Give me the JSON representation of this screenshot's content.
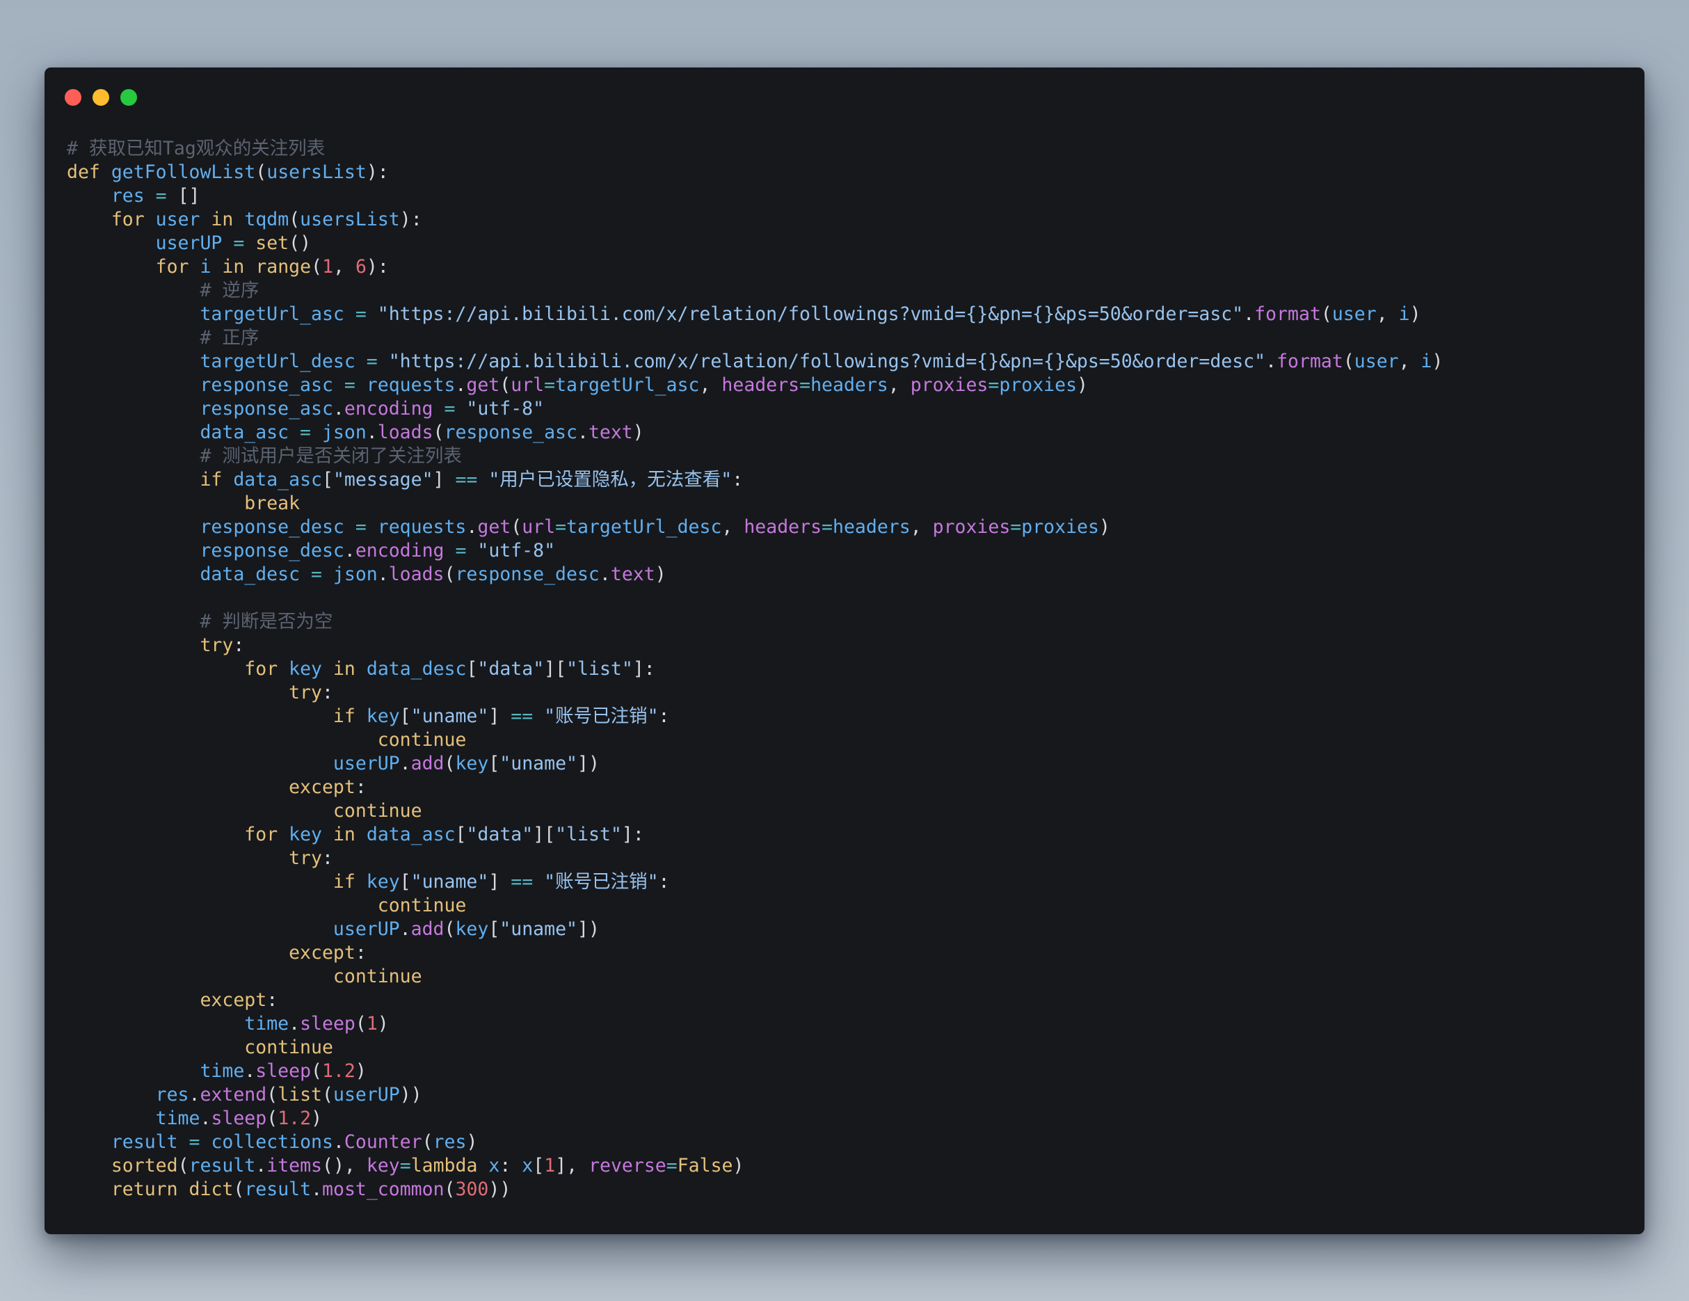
{
  "window": {
    "controls": [
      {
        "name": "close",
        "color": "#ff5f57"
      },
      {
        "name": "minimize",
        "color": "#febc2e"
      },
      {
        "name": "maximize",
        "color": "#28c840"
      }
    ]
  },
  "code": {
    "language": "python",
    "lines": [
      [
        [
          "cm",
          "# 获取已知Tag观众的关注列表"
        ]
      ],
      [
        [
          "kw",
          "def"
        ],
        [
          "pu",
          " "
        ],
        [
          "fn",
          "getFollowList"
        ],
        [
          "pu",
          "("
        ],
        [
          "id",
          "usersList"
        ],
        [
          "pu",
          "):"
        ]
      ],
      [
        [
          "pu",
          "    "
        ],
        [
          "id",
          "res"
        ],
        [
          "op",
          " = "
        ],
        [
          "pu",
          "[]"
        ]
      ],
      [
        [
          "pu",
          "    "
        ],
        [
          "kw",
          "for"
        ],
        [
          "pu",
          " "
        ],
        [
          "id",
          "user"
        ],
        [
          "pu",
          " "
        ],
        [
          "kw",
          "in"
        ],
        [
          "pu",
          " "
        ],
        [
          "fn",
          "tqdm"
        ],
        [
          "pu",
          "("
        ],
        [
          "id",
          "usersList"
        ],
        [
          "pu",
          "):"
        ]
      ],
      [
        [
          "pu",
          "        "
        ],
        [
          "id",
          "userUP"
        ],
        [
          "op",
          " = "
        ],
        [
          "bi",
          "set"
        ],
        [
          "pu",
          "()"
        ]
      ],
      [
        [
          "pu",
          "        "
        ],
        [
          "kw",
          "for"
        ],
        [
          "pu",
          " "
        ],
        [
          "id",
          "i"
        ],
        [
          "pu",
          " "
        ],
        [
          "kw",
          "in"
        ],
        [
          "pu",
          " "
        ],
        [
          "bi",
          "range"
        ],
        [
          "pu",
          "("
        ],
        [
          "nu",
          "1"
        ],
        [
          "pu",
          ", "
        ],
        [
          "nu",
          "6"
        ],
        [
          "pu",
          "):"
        ]
      ],
      [
        [
          "pu",
          "            "
        ],
        [
          "cm",
          "# 逆序"
        ]
      ],
      [
        [
          "pu",
          "            "
        ],
        [
          "id",
          "targetUrl_asc"
        ],
        [
          "op",
          " = "
        ],
        [
          "st",
          "\"https://api.bilibili.com/x/relation/followings?vmid={}&pn={}&ps=50&order=asc\""
        ],
        [
          "pu",
          "."
        ],
        [
          "me",
          "format"
        ],
        [
          "pu",
          "("
        ],
        [
          "id",
          "user"
        ],
        [
          "pu",
          ", "
        ],
        [
          "id",
          "i"
        ],
        [
          "pu",
          ")"
        ]
      ],
      [
        [
          "pu",
          "            "
        ],
        [
          "cm",
          "# 正序"
        ]
      ],
      [
        [
          "pu",
          "            "
        ],
        [
          "id",
          "targetUrl_desc"
        ],
        [
          "op",
          " = "
        ],
        [
          "st",
          "\"https://api.bilibili.com/x/relation/followings?vmid={}&pn={}&ps=50&order=desc\""
        ],
        [
          "pu",
          "."
        ],
        [
          "me",
          "format"
        ],
        [
          "pu",
          "("
        ],
        [
          "id",
          "user"
        ],
        [
          "pu",
          ", "
        ],
        [
          "id",
          "i"
        ],
        [
          "pu",
          ")"
        ]
      ],
      [
        [
          "pu",
          "            "
        ],
        [
          "id",
          "response_asc"
        ],
        [
          "op",
          " = "
        ],
        [
          "id",
          "requests"
        ],
        [
          "pu",
          "."
        ],
        [
          "me",
          "get"
        ],
        [
          "pu",
          "("
        ],
        [
          "pn",
          "url"
        ],
        [
          "op",
          "="
        ],
        [
          "id",
          "targetUrl_asc"
        ],
        [
          "pu",
          ", "
        ],
        [
          "pn",
          "headers"
        ],
        [
          "op",
          "="
        ],
        [
          "id",
          "headers"
        ],
        [
          "pu",
          ", "
        ],
        [
          "pn",
          "proxies"
        ],
        [
          "op",
          "="
        ],
        [
          "id",
          "proxies"
        ],
        [
          "pu",
          ")"
        ]
      ],
      [
        [
          "pu",
          "            "
        ],
        [
          "id",
          "response_asc"
        ],
        [
          "pu",
          "."
        ],
        [
          "me",
          "encoding"
        ],
        [
          "op",
          " = "
        ],
        [
          "st",
          "\"utf-8\""
        ]
      ],
      [
        [
          "pu",
          "            "
        ],
        [
          "id",
          "data_asc"
        ],
        [
          "op",
          " = "
        ],
        [
          "id",
          "json"
        ],
        [
          "pu",
          "."
        ],
        [
          "me",
          "loads"
        ],
        [
          "pu",
          "("
        ],
        [
          "id",
          "response_asc"
        ],
        [
          "pu",
          "."
        ],
        [
          "me",
          "text"
        ],
        [
          "pu",
          ")"
        ]
      ],
      [
        [
          "pu",
          "            "
        ],
        [
          "cm",
          "# 测试用户是否关闭了关注列表"
        ]
      ],
      [
        [
          "pu",
          "            "
        ],
        [
          "kw",
          "if"
        ],
        [
          "pu",
          " "
        ],
        [
          "id",
          "data_asc"
        ],
        [
          "pu",
          "["
        ],
        [
          "st",
          "\"message\""
        ],
        [
          "pu",
          "]"
        ],
        [
          "op",
          " == "
        ],
        [
          "st",
          "\"用户已设置隐私，无法查看\""
        ],
        [
          "pu",
          ":"
        ]
      ],
      [
        [
          "pu",
          "                "
        ],
        [
          "kw",
          "break"
        ]
      ],
      [
        [
          "pu",
          "            "
        ],
        [
          "id",
          "response_desc"
        ],
        [
          "op",
          " = "
        ],
        [
          "id",
          "requests"
        ],
        [
          "pu",
          "."
        ],
        [
          "me",
          "get"
        ],
        [
          "pu",
          "("
        ],
        [
          "pn",
          "url"
        ],
        [
          "op",
          "="
        ],
        [
          "id",
          "targetUrl_desc"
        ],
        [
          "pu",
          ", "
        ],
        [
          "pn",
          "headers"
        ],
        [
          "op",
          "="
        ],
        [
          "id",
          "headers"
        ],
        [
          "pu",
          ", "
        ],
        [
          "pn",
          "proxies"
        ],
        [
          "op",
          "="
        ],
        [
          "id",
          "proxies"
        ],
        [
          "pu",
          ")"
        ]
      ],
      [
        [
          "pu",
          "            "
        ],
        [
          "id",
          "response_desc"
        ],
        [
          "pu",
          "."
        ],
        [
          "me",
          "encoding"
        ],
        [
          "op",
          " = "
        ],
        [
          "st",
          "\"utf-8\""
        ]
      ],
      [
        [
          "pu",
          "            "
        ],
        [
          "id",
          "data_desc"
        ],
        [
          "op",
          " = "
        ],
        [
          "id",
          "json"
        ],
        [
          "pu",
          "."
        ],
        [
          "me",
          "loads"
        ],
        [
          "pu",
          "("
        ],
        [
          "id",
          "response_desc"
        ],
        [
          "pu",
          "."
        ],
        [
          "me",
          "text"
        ],
        [
          "pu",
          ")"
        ]
      ],
      [],
      [
        [
          "pu",
          "            "
        ],
        [
          "cm",
          "# 判断是否为空"
        ]
      ],
      [
        [
          "pu",
          "            "
        ],
        [
          "kw",
          "try"
        ],
        [
          "pu",
          ":"
        ]
      ],
      [
        [
          "pu",
          "                "
        ],
        [
          "kw",
          "for"
        ],
        [
          "pu",
          " "
        ],
        [
          "id",
          "key"
        ],
        [
          "pu",
          " "
        ],
        [
          "kw",
          "in"
        ],
        [
          "pu",
          " "
        ],
        [
          "id",
          "data_desc"
        ],
        [
          "pu",
          "["
        ],
        [
          "st",
          "\"data\""
        ],
        [
          "pu",
          "]["
        ],
        [
          "st",
          "\"list\""
        ],
        [
          "pu",
          "]:"
        ]
      ],
      [
        [
          "pu",
          "                    "
        ],
        [
          "kw",
          "try"
        ],
        [
          "pu",
          ":"
        ]
      ],
      [
        [
          "pu",
          "                        "
        ],
        [
          "kw",
          "if"
        ],
        [
          "pu",
          " "
        ],
        [
          "id",
          "key"
        ],
        [
          "pu",
          "["
        ],
        [
          "st",
          "\"uname\""
        ],
        [
          "pu",
          "]"
        ],
        [
          "op",
          " == "
        ],
        [
          "st",
          "\"账号已注销\""
        ],
        [
          "pu",
          ":"
        ]
      ],
      [
        [
          "pu",
          "                            "
        ],
        [
          "kw",
          "continue"
        ]
      ],
      [
        [
          "pu",
          "                        "
        ],
        [
          "id",
          "userUP"
        ],
        [
          "pu",
          "."
        ],
        [
          "me",
          "add"
        ],
        [
          "pu",
          "("
        ],
        [
          "id",
          "key"
        ],
        [
          "pu",
          "["
        ],
        [
          "st",
          "\"uname\""
        ],
        [
          "pu",
          "])"
        ]
      ],
      [
        [
          "pu",
          "                    "
        ],
        [
          "kw",
          "except"
        ],
        [
          "pu",
          ":"
        ]
      ],
      [
        [
          "pu",
          "                        "
        ],
        [
          "kw",
          "continue"
        ]
      ],
      [
        [
          "pu",
          "                "
        ],
        [
          "kw",
          "for"
        ],
        [
          "pu",
          " "
        ],
        [
          "id",
          "key"
        ],
        [
          "pu",
          " "
        ],
        [
          "kw",
          "in"
        ],
        [
          "pu",
          " "
        ],
        [
          "id",
          "data_asc"
        ],
        [
          "pu",
          "["
        ],
        [
          "st",
          "\"data\""
        ],
        [
          "pu",
          "]["
        ],
        [
          "st",
          "\"list\""
        ],
        [
          "pu",
          "]:"
        ]
      ],
      [
        [
          "pu",
          "                    "
        ],
        [
          "kw",
          "try"
        ],
        [
          "pu",
          ":"
        ]
      ],
      [
        [
          "pu",
          "                        "
        ],
        [
          "kw",
          "if"
        ],
        [
          "pu",
          " "
        ],
        [
          "id",
          "key"
        ],
        [
          "pu",
          "["
        ],
        [
          "st",
          "\"uname\""
        ],
        [
          "pu",
          "]"
        ],
        [
          "op",
          " == "
        ],
        [
          "st",
          "\"账号已注销\""
        ],
        [
          "pu",
          ":"
        ]
      ],
      [
        [
          "pu",
          "                            "
        ],
        [
          "kw",
          "continue"
        ]
      ],
      [
        [
          "pu",
          "                        "
        ],
        [
          "id",
          "userUP"
        ],
        [
          "pu",
          "."
        ],
        [
          "me",
          "add"
        ],
        [
          "pu",
          "("
        ],
        [
          "id",
          "key"
        ],
        [
          "pu",
          "["
        ],
        [
          "st",
          "\"uname\""
        ],
        [
          "pu",
          "])"
        ]
      ],
      [
        [
          "pu",
          "                    "
        ],
        [
          "kw",
          "except"
        ],
        [
          "pu",
          ":"
        ]
      ],
      [
        [
          "pu",
          "                        "
        ],
        [
          "kw",
          "continue"
        ]
      ],
      [
        [
          "pu",
          "            "
        ],
        [
          "kw",
          "except"
        ],
        [
          "pu",
          ":"
        ]
      ],
      [
        [
          "pu",
          "                "
        ],
        [
          "id",
          "time"
        ],
        [
          "pu",
          "."
        ],
        [
          "me",
          "sleep"
        ],
        [
          "pu",
          "("
        ],
        [
          "nu",
          "1"
        ],
        [
          "pu",
          ")"
        ]
      ],
      [
        [
          "pu",
          "                "
        ],
        [
          "kw",
          "continue"
        ]
      ],
      [
        [
          "pu",
          "            "
        ],
        [
          "id",
          "time"
        ],
        [
          "pu",
          "."
        ],
        [
          "me",
          "sleep"
        ],
        [
          "pu",
          "("
        ],
        [
          "nu",
          "1.2"
        ],
        [
          "pu",
          ")"
        ]
      ],
      [
        [
          "pu",
          "        "
        ],
        [
          "id",
          "res"
        ],
        [
          "pu",
          "."
        ],
        [
          "me",
          "extend"
        ],
        [
          "pu",
          "("
        ],
        [
          "bi",
          "list"
        ],
        [
          "pu",
          "("
        ],
        [
          "id",
          "userUP"
        ],
        [
          "pu",
          "))"
        ]
      ],
      [
        [
          "pu",
          "        "
        ],
        [
          "id",
          "time"
        ],
        [
          "pu",
          "."
        ],
        [
          "me",
          "sleep"
        ],
        [
          "pu",
          "("
        ],
        [
          "nu",
          "1.2"
        ],
        [
          "pu",
          ")"
        ]
      ],
      [
        [
          "pu",
          "    "
        ],
        [
          "id",
          "result"
        ],
        [
          "op",
          " = "
        ],
        [
          "id",
          "collections"
        ],
        [
          "pu",
          "."
        ],
        [
          "me",
          "Counter"
        ],
        [
          "pu",
          "("
        ],
        [
          "id",
          "res"
        ],
        [
          "pu",
          ")"
        ]
      ],
      [
        [
          "pu",
          "    "
        ],
        [
          "bi",
          "sorted"
        ],
        [
          "pu",
          "("
        ],
        [
          "id",
          "result"
        ],
        [
          "pu",
          "."
        ],
        [
          "me",
          "items"
        ],
        [
          "pu",
          "(), "
        ],
        [
          "pn",
          "key"
        ],
        [
          "op",
          "="
        ],
        [
          "kw",
          "lambda"
        ],
        [
          "pu",
          " "
        ],
        [
          "id",
          "x"
        ],
        [
          "pu",
          ": "
        ],
        [
          "id",
          "x"
        ],
        [
          "pu",
          "["
        ],
        [
          "nu",
          "1"
        ],
        [
          "pu",
          "], "
        ],
        [
          "pn",
          "reverse"
        ],
        [
          "op",
          "="
        ],
        [
          "co",
          "False"
        ],
        [
          "pu",
          ")"
        ]
      ],
      [
        [
          "pu",
          "    "
        ],
        [
          "kw",
          "return"
        ],
        [
          "pu",
          " "
        ],
        [
          "bi",
          "dict"
        ],
        [
          "pu",
          "("
        ],
        [
          "id",
          "result"
        ],
        [
          "pu",
          "."
        ],
        [
          "me",
          "most_common"
        ],
        [
          "pu",
          "("
        ],
        [
          "nu",
          "300"
        ],
        [
          "pu",
          "))"
        ]
      ]
    ]
  }
}
